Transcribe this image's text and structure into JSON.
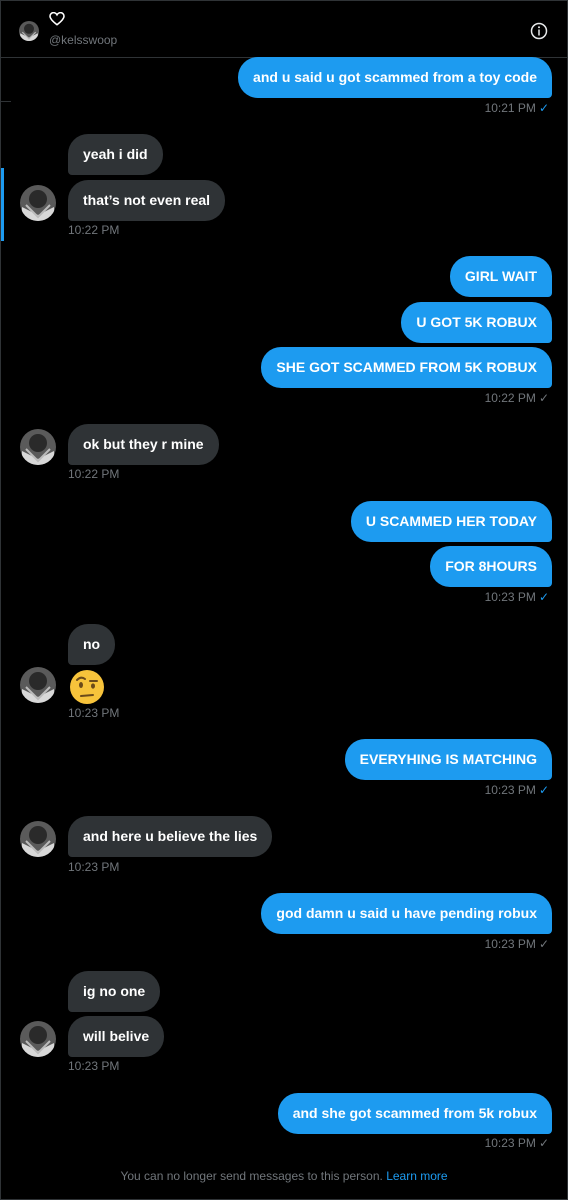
{
  "header": {
    "handle": "@kelsswoop",
    "heart_icon": "heart-outline-icon",
    "info_icon": "info-icon"
  },
  "messages": {
    "m1": "and u said u got scammed from a toy code",
    "t1": "10:21 PM",
    "m2": "yeah i did",
    "m3": "that’s not even real",
    "t2": "10:22 PM",
    "m4": "GIRL WAIT",
    "m5": "U GOT 5K ROBUX",
    "m6": "SHE GOT SCAMMED FROM 5K ROBUX",
    "t3": "10:22 PM",
    "m7": "ok but they r mine",
    "t4": "10:22 PM",
    "m8": "U SCAMMED HER TODAY",
    "m9": "FOR 8HOURS",
    "t5": "10:23 PM",
    "m10": "no",
    "m11_emoji": "face-with-raised-eyebrow",
    "t6": "10:23 PM",
    "m12": "EVERYHING IS MATCHING",
    "t7": "10:23 PM",
    "m13": "and here u believe the lies",
    "t8": "10:23 PM",
    "m14": "god damn u said u have pending robux",
    "t9": "10:23 PM",
    "m15": "ig no one",
    "m16": "will belive",
    "t10": "10:23 PM",
    "m17": "and she got scammed from 5k robux",
    "t11": "10:23 PM"
  },
  "footer": {
    "text": "You can no longer send messages to this person.",
    "link": "Learn more"
  },
  "colors": {
    "accent": "#1d9bf0",
    "incoming_bubble": "#2f3336",
    "muted_text": "#71767b"
  }
}
